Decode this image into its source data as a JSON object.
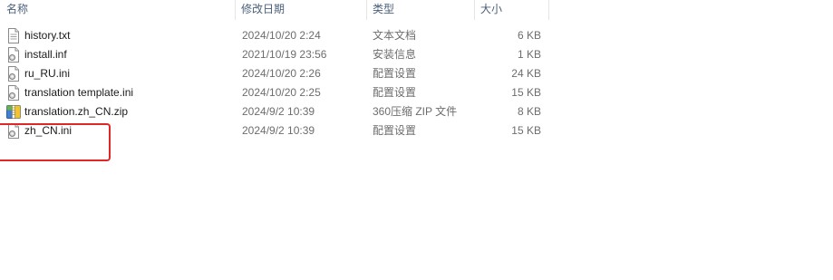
{
  "header": {
    "columns": [
      {
        "label": "名称"
      },
      {
        "label": "修改日期"
      },
      {
        "label": "类型"
      },
      {
        "label": "大小"
      }
    ]
  },
  "files": [
    {
      "name": "history.txt",
      "date": "2024/10/20 2:24",
      "type": "文本文档",
      "size": "6 KB",
      "icon": "text-document-icon"
    },
    {
      "name": "install.inf",
      "date": "2021/10/19 23:56",
      "type": "安装信息",
      "size": "1 KB",
      "icon": "settings-file-icon"
    },
    {
      "name": "ru_RU.ini",
      "date": "2024/10/20 2:26",
      "type": "配置设置",
      "size": "24 KB",
      "icon": "settings-file-icon"
    },
    {
      "name": "translation template.ini",
      "date": "2024/10/20 2:25",
      "type": "配置设置",
      "size": "15 KB",
      "icon": "settings-file-icon"
    },
    {
      "name": "translation.zh_CN.zip",
      "date": "2024/9/2 10:39",
      "type": "360压缩 ZIP 文件",
      "size": "8 KB",
      "icon": "zip-archive-icon"
    },
    {
      "name": "zh_CN.ini",
      "date": "2024/9/2 10:39",
      "type": "配置设置",
      "size": "15 KB",
      "icon": "settings-file-icon"
    }
  ],
  "colors": {
    "highlight": "#e02626",
    "header_text": "#4c607a",
    "secondary_text": "#6d6d6d"
  }
}
